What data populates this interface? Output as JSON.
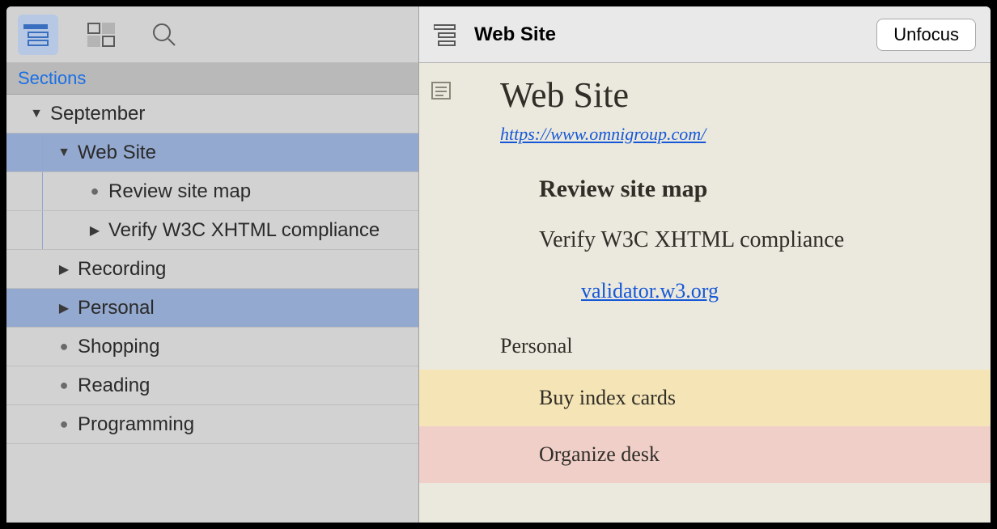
{
  "sidebar": {
    "header_label": "Sections",
    "toolbar": {
      "sections_active": true
    },
    "tree": [
      {
        "id": "september",
        "label": "September",
        "indent": 0,
        "marker": "disclosure-down",
        "selected": false
      },
      {
        "id": "web-site",
        "label": "Web Site",
        "indent": 1,
        "marker": "disclosure-down",
        "selected": true,
        "guide": true
      },
      {
        "id": "review-site-map",
        "label": "Review site map",
        "indent": 2,
        "marker": "bullet",
        "selected": false,
        "guide": true
      },
      {
        "id": "verify-w3c",
        "label": "Verify W3C XHTML compliance",
        "indent": 2,
        "marker": "disclosure-right",
        "selected": false,
        "guide": true
      },
      {
        "id": "recording",
        "label": "Recording",
        "indent": 1,
        "marker": "disclosure-right",
        "selected": false
      },
      {
        "id": "personal",
        "label": "Personal",
        "indent": 1,
        "marker": "disclosure-right",
        "selected": true
      },
      {
        "id": "shopping",
        "label": "Shopping",
        "indent": 1,
        "marker": "bullet",
        "selected": false
      },
      {
        "id": "reading",
        "label": "Reading",
        "indent": 1,
        "marker": "bullet",
        "selected": false
      },
      {
        "id": "programming",
        "label": "Programming",
        "indent": 1,
        "marker": "bullet",
        "selected": false
      }
    ]
  },
  "main": {
    "header_title": "Web Site",
    "unfocus_label": "Unfocus",
    "doc_title": "Web Site",
    "doc_url": "https://www.omnigroup.com/",
    "heading_review": "Review site map",
    "heading_verify": "Verify W3C XHTML compliance",
    "validator_link": "validator.w3.org",
    "section_personal": "Personal",
    "item_buy": "Buy index cards",
    "item_organize": "Organize desk"
  }
}
